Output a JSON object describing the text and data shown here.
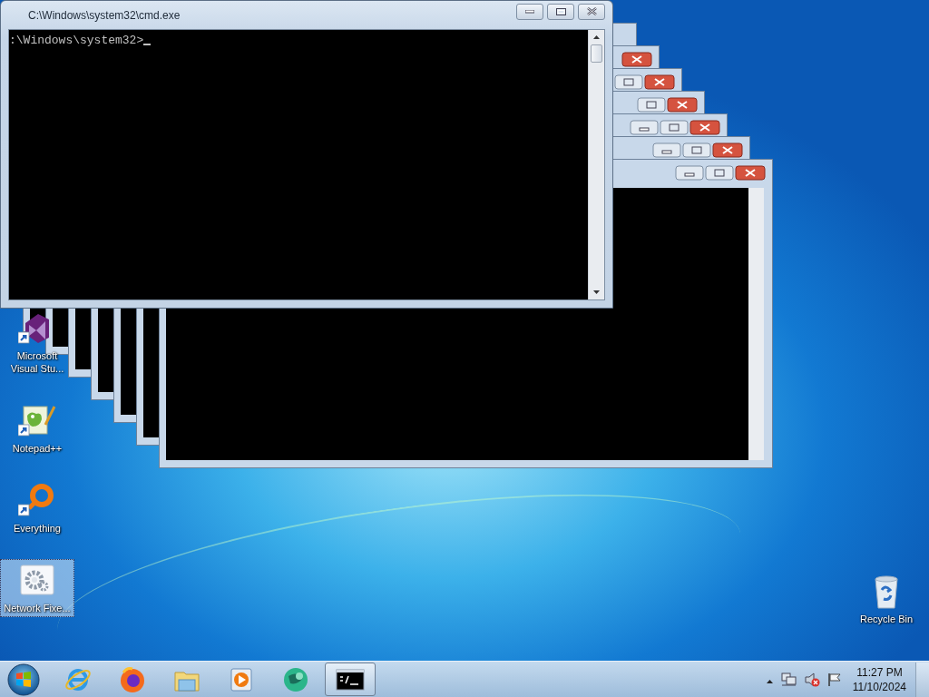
{
  "console_window": {
    "title": "C:\\Windows\\system32\\cmd.exe",
    "lines": [
      ":\\Windows\\system32>"
    ]
  },
  "desktop_icons": [
    {
      "kind": "visual-studio",
      "label": "Microsoft Visual Stu...",
      "selected": false
    },
    {
      "kind": "notepad",
      "label": "Notepad++",
      "selected": false
    },
    {
      "kind": "everything",
      "label": "Everything",
      "selected": false
    },
    {
      "kind": "network-fixer",
      "label": "Network Fixe...",
      "selected": true
    }
  ],
  "recycle_bin": {
    "label": "Recycle Bin",
    "selected": false
  },
  "taskbar": {
    "pinned": [
      {
        "kind": "internet-explorer",
        "selected": false
      },
      {
        "kind": "firefox",
        "selected": false
      },
      {
        "kind": "file-explorer",
        "selected": false
      },
      {
        "kind": "media-player",
        "selected": false
      },
      {
        "kind": "green-globe",
        "selected": false
      },
      {
        "kind": "command-prompt",
        "selected": true
      }
    ],
    "tray": {
      "sound_muted": true,
      "time": "11:27 PM",
      "date": "11/10/2024"
    }
  }
}
